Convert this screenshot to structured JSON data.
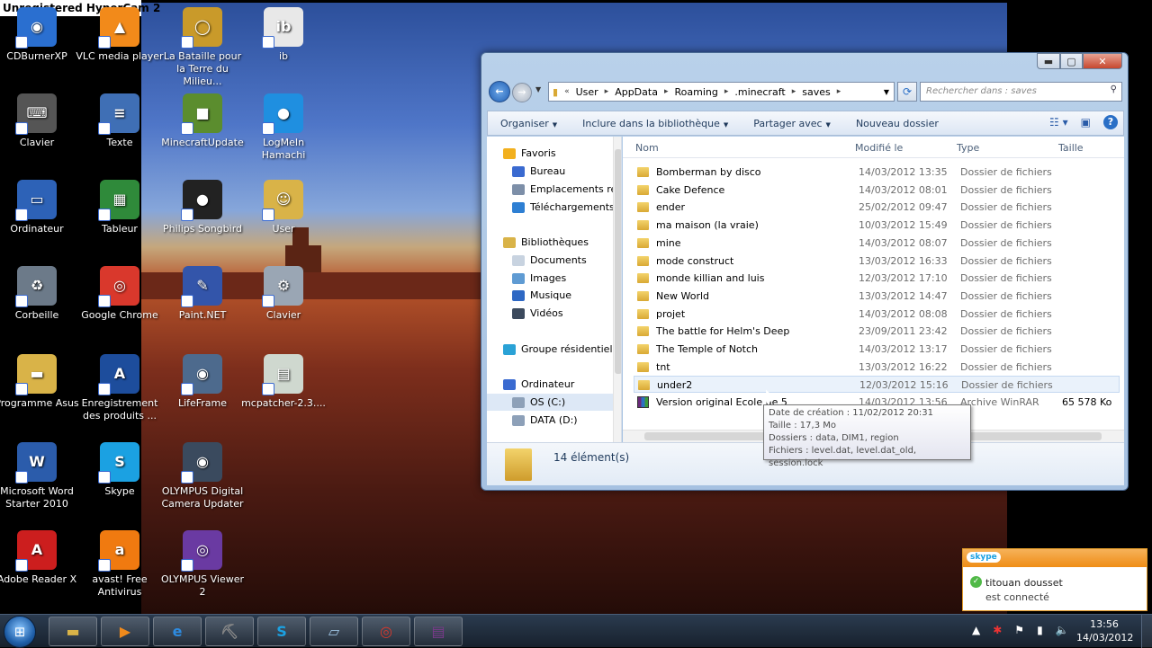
{
  "watermark": "Unregistered HyperCam 2",
  "desktop_icons": [
    {
      "label": "CDBurnerXP",
      "icon": "disc-burner-icon",
      "color": "#2a6fd0",
      "glyph": "◉"
    },
    {
      "label": "VLC media player",
      "icon": "vlc-cone-icon",
      "color": "#f28a1a",
      "glyph": "▲"
    },
    {
      "label": "La Bataille pour la Terre du Milieu...",
      "icon": "ring-icon",
      "color": "#c99a2a",
      "glyph": "◯"
    },
    {
      "label": "ib",
      "icon": "ib-logo-icon",
      "color": "#e8e8e8",
      "glyph": "ib"
    },
    {
      "label": "Clavier",
      "icon": "keyboard-icon",
      "color": "#555",
      "glyph": "⌨"
    },
    {
      "label": "Texte",
      "icon": "text-document-icon",
      "color": "#3f6fb5",
      "glyph": "≡"
    },
    {
      "label": "MinecraftUpdate",
      "icon": "minecraft-block-icon",
      "color": "#5b8d2e",
      "glyph": "■"
    },
    {
      "label": "LogMeIn Hamachi",
      "icon": "hamachi-icon",
      "color": "#1f8fe0",
      "glyph": "●"
    },
    {
      "label": "Ordinateur",
      "icon": "computer-icon",
      "color": "#2d62b7",
      "glyph": "▭"
    },
    {
      "label": "Tableur",
      "icon": "spreadsheet-icon",
      "color": "#2f8a3a",
      "glyph": "▦"
    },
    {
      "label": "Philips Songbird",
      "icon": "songbird-icon",
      "color": "#222",
      "glyph": "●"
    },
    {
      "label": "User",
      "icon": "user-folder-icon",
      "color": "#d9b348",
      "glyph": "☺"
    },
    {
      "label": "Corbeille",
      "icon": "recycle-bin-icon",
      "color": "#6c7a89",
      "glyph": "♻"
    },
    {
      "label": "Google Chrome",
      "icon": "chrome-icon",
      "color": "#d9382c",
      "glyph": "◎"
    },
    {
      "label": "Paint.NET",
      "icon": "paint-icon",
      "color": "#3355aa",
      "glyph": "✎"
    },
    {
      "label": "Clavier",
      "icon": "keyboard-file-icon",
      "color": "#9aa6b4",
      "glyph": "⚙"
    },
    {
      "label": "Programme Asus",
      "icon": "folder-icon",
      "color": "#d9b348",
      "glyph": "▬"
    },
    {
      "label": "Enregistrement des produits ...",
      "icon": "asus-icon",
      "color": "#1d4d9c",
      "glyph": "A"
    },
    {
      "label": "LifeFrame",
      "icon": "lifeframe-icon",
      "color": "#4d6a8d",
      "glyph": "◉"
    },
    {
      "label": "mcpatcher-2.3....",
      "icon": "mcpatcher-icon",
      "color": "#cfd8cf",
      "glyph": "▤"
    },
    {
      "label": "Microsoft Word Starter 2010",
      "icon": "word-icon",
      "color": "#2b5cab",
      "glyph": "W"
    },
    {
      "label": "Skype",
      "icon": "skype-icon",
      "color": "#1ba1e2",
      "glyph": "S"
    },
    {
      "label": "OLYMPUS Digital Camera Updater",
      "icon": "olympus-camera-icon",
      "color": "#3a4a5e",
      "glyph": "◉"
    },
    {
      "label": "Adobe Reader X",
      "icon": "adobe-reader-icon",
      "color": "#cc1e1e",
      "glyph": "A"
    },
    {
      "label": "avast! Free Antivirus",
      "icon": "avast-icon",
      "color": "#f07a10",
      "glyph": "a"
    },
    {
      "label": "OLYMPUS Viewer 2",
      "icon": "olympus-viewer-icon",
      "color": "#6a3aa2",
      "glyph": "◎"
    }
  ],
  "explorer": {
    "address": [
      "User",
      "AppData",
      "Roaming",
      ".minecraft",
      "saves"
    ],
    "search_placeholder": "Rechercher dans : saves",
    "toolbar": {
      "organize": "Organiser",
      "include": "Inclure dans la bibliothèque",
      "share": "Partager avec",
      "new_folder": "Nouveau dossier"
    },
    "nav": [
      {
        "label": "Favoris",
        "icon": "star-icon",
        "color": "#f2b01e",
        "indent": 0
      },
      {
        "label": "Bureau",
        "icon": "desktop-icon",
        "color": "#3a6ad0",
        "indent": 1
      },
      {
        "label": "Emplacements ré",
        "icon": "recent-places-icon",
        "color": "#7d8fa8",
        "indent": 1
      },
      {
        "label": "Téléchargements",
        "icon": "downloads-icon",
        "color": "#2e7fd3",
        "indent": 1
      },
      {
        "label": "Bibliothèques",
        "icon": "libraries-icon",
        "color": "#d9b348",
        "indent": 0
      },
      {
        "label": "Documents",
        "icon": "documents-icon",
        "color": "#c8d3e0",
        "indent": 1
      },
      {
        "label": "Images",
        "icon": "images-icon",
        "color": "#5f9bd3",
        "indent": 1
      },
      {
        "label": "Musique",
        "icon": "music-icon",
        "color": "#2e68c4",
        "indent": 1
      },
      {
        "label": "Vidéos",
        "icon": "videos-icon",
        "color": "#3c4a5d",
        "indent": 1
      },
      {
        "label": "Groupe résidentiel",
        "icon": "homegroup-icon",
        "color": "#2aa2d6",
        "indent": 0
      },
      {
        "label": "Ordinateur",
        "icon": "computer-icon",
        "color": "#3a6ad0",
        "indent": 0
      },
      {
        "label": "OS (C:)",
        "icon": "drive-c-icon",
        "color": "#8da0b8",
        "indent": 1
      },
      {
        "label": "DATA (D:)",
        "icon": "drive-d-icon",
        "color": "#8da0b8",
        "indent": 1
      }
    ],
    "columns": {
      "name": "Nom",
      "modified": "Modifié le",
      "type": "Type",
      "size": "Taille"
    },
    "files": [
      {
        "name": "Bomberman by disco",
        "date": "14/03/2012 13:35",
        "type": "Dossier de fichiers",
        "size": ""
      },
      {
        "name": "Cake Defence",
        "date": "14/03/2012 08:01",
        "type": "Dossier de fichiers",
        "size": ""
      },
      {
        "name": "ender",
        "date": "25/02/2012 09:47",
        "type": "Dossier de fichiers",
        "size": ""
      },
      {
        "name": "ma maison (la vraie)",
        "date": "10/03/2012 15:49",
        "type": "Dossier de fichiers",
        "size": ""
      },
      {
        "name": "mine",
        "date": "14/03/2012 08:07",
        "type": "Dossier de fichiers",
        "size": ""
      },
      {
        "name": "mode construct",
        "date": "13/03/2012 16:33",
        "type": "Dossier de fichiers",
        "size": ""
      },
      {
        "name": "monde killian and luis",
        "date": "12/03/2012 17:10",
        "type": "Dossier de fichiers",
        "size": ""
      },
      {
        "name": "New World",
        "date": "13/03/2012 14:47",
        "type": "Dossier de fichiers",
        "size": ""
      },
      {
        "name": "projet",
        "date": "14/03/2012 08:08",
        "type": "Dossier de fichiers",
        "size": ""
      },
      {
        "name": "The battle for Helm's Deep",
        "date": "23/09/2011 23:42",
        "type": "Dossier de fichiers",
        "size": ""
      },
      {
        "name": "The Temple of Notch",
        "date": "14/03/2012 13:17",
        "type": "Dossier de fichiers",
        "size": ""
      },
      {
        "name": "tnt",
        "date": "13/03/2012 16:22",
        "type": "Dossier de fichiers",
        "size": ""
      },
      {
        "name": "under2",
        "date": "12/03/2012 15:16",
        "type": "Dossier de fichiers",
        "size": ""
      },
      {
        "name": "Version original Ecole de 5",
        "date": "14/03/2012 13:56",
        "type": "Archive WinRAR",
        "size": "65 578 Ko"
      }
    ],
    "status": "14 élément(s)",
    "tooltip": [
      "Date de création : 11/02/2012 20:31",
      "Taille : 17,3 Mo",
      "Dossiers : data, DIM1, region",
      "Fichiers : level.dat, level.dat_old, session.lock"
    ]
  },
  "skype_popup": {
    "brand": "skype",
    "name": "titouan dousset",
    "status": "est connecté"
  },
  "taskbar": {
    "items": [
      {
        "icon": "explorer-folder-icon",
        "glyph": "▬",
        "color": "#d9b348"
      },
      {
        "icon": "media-player-icon",
        "glyph": "▶",
        "color": "#f08a1c"
      },
      {
        "icon": "internet-explorer-icon",
        "glyph": "e",
        "color": "#2d8be0"
      },
      {
        "icon": "minecraft-icon",
        "glyph": "⛏",
        "color": "#888"
      },
      {
        "icon": "skype-icon",
        "glyph": "S",
        "color": "#1ba1e2"
      },
      {
        "icon": "notes-icon",
        "glyph": "▱",
        "color": "#9bc1e0"
      },
      {
        "icon": "chrome-icon",
        "glyph": "◎",
        "color": "#d9382c"
      },
      {
        "icon": "winrar-icon",
        "glyph": "▤",
        "color": "#7a3a8a"
      }
    ],
    "time": "13:56",
    "date": "14/03/2012"
  }
}
